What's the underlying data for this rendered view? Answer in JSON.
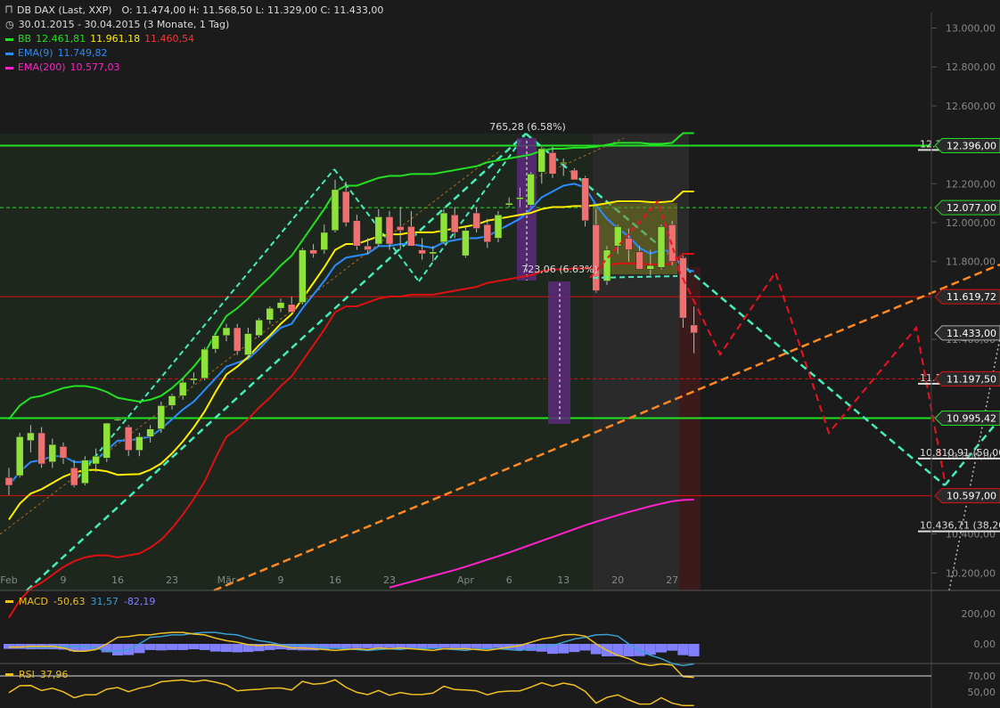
{
  "header": {
    "title": "DB DAX (Last, XXP)",
    "ohlc": "O: 11.474,00  H: 11.568,50  L: 11.329,00  C: 11.433,00",
    "period": "30.01.2015 - 30.04.2015 (3 Monate, 1 Tag)",
    "bb_label": "BB",
    "bb_upper": "12.461,81",
    "bb_mid": "11.961,18",
    "bb_lower": "11.460,54",
    "ema9_label": "EMA(9)",
    "ema9_value": "11.749,82",
    "ema200_label": "EMA(200)",
    "ema200_value": "10.577,03"
  },
  "colors": {
    "background": "#1b1b1b",
    "up_candle": "#8fe23a",
    "down_candle": "#f07070",
    "bb_upper": "#22e022",
    "bb_mid": "#ffee00",
    "bb_lower": "#dd1111",
    "ema9": "#2a8cff",
    "ema200": "#ff22cc",
    "channel": "#44eebb",
    "support_line": "#ff8822",
    "projection": "#ee1122",
    "macd": "#f0c020",
    "macd_signal": "#3aa0d0",
    "macd_hist": "#8080ff",
    "rsi": "#f0c020"
  },
  "annotations": {
    "top_measure": "765,28 (6.58%)",
    "mid_measure": "723,06 (6.63%)"
  },
  "price_badges": [
    {
      "label": "12.396,00",
      "value": 12396,
      "color": "#22e022"
    },
    {
      "label": "12.077,00",
      "value": 12077,
      "color": "#22e022"
    },
    {
      "label": "11.619,72",
      "value": 11619.72,
      "color": "#dd1111"
    },
    {
      "label": "11.433,00",
      "value": 11433,
      "color": "#aaaaaa"
    },
    {
      "label": "11.197,50",
      "value": 11197.5,
      "color": "#dd1111"
    },
    {
      "label": "10.995,42",
      "value": 10995.42,
      "color": "#22e022"
    },
    {
      "label": "10.597,00",
      "value": 10597,
      "color": "#dd1111"
    }
  ],
  "fib_labels": [
    {
      "label": "12.396,40 (100,0",
      "value": 12396.4
    },
    {
      "label": "11.195,11 (61,80",
      "value": 11195.11
    },
    {
      "label": "10.810,91 (50,00",
      "value": 10810.91
    },
    {
      "label": "10.436,71 (38,20",
      "value": 10436.71
    }
  ],
  "chart_data": {
    "type": "candlestick",
    "ylim": [
      10110,
      13080
    ],
    "y_ticks": [
      "13.000,00",
      "12.800,00",
      "12.600,00",
      "12.200,00",
      "12.000,00",
      "11.800,00",
      "11.400,00",
      "11.000,00",
      "10.800,00",
      "10.400,00",
      "10.200,00"
    ],
    "y_tick_values": [
      13000,
      12800,
      12600,
      12200,
      12000,
      11800,
      11400,
      11000,
      10800,
      10400,
      10200
    ],
    "x_labels": [
      "Feb",
      "9",
      "16",
      "23",
      "Mär",
      "9",
      "16",
      "23",
      "Apr",
      "6",
      "13",
      "20",
      "27"
    ],
    "x_label_index": [
      0,
      5,
      10,
      15,
      20,
      25,
      30,
      35,
      42,
      46,
      51,
      56,
      61
    ],
    "candles": [
      {
        "o": 10690,
        "h": 10740,
        "l": 10600,
        "c": 10650
      },
      {
        "o": 10700,
        "h": 10920,
        "l": 10690,
        "c": 10900
      },
      {
        "o": 10880,
        "h": 10960,
        "l": 10820,
        "c": 10920
      },
      {
        "o": 10920,
        "h": 10950,
        "l": 10740,
        "c": 10760
      },
      {
        "o": 10770,
        "h": 10890,
        "l": 10740,
        "c": 10860
      },
      {
        "o": 10850,
        "h": 10870,
        "l": 10760,
        "c": 10790
      },
      {
        "o": 10740,
        "h": 10780,
        "l": 10640,
        "c": 10650
      },
      {
        "o": 10660,
        "h": 10800,
        "l": 10650,
        "c": 10780
      },
      {
        "o": 10760,
        "h": 10840,
        "l": 10720,
        "c": 10800
      },
      {
        "o": 10790,
        "h": 10970,
        "l": 10770,
        "c": 10970
      },
      {
        "o": 10990,
        "h": 11000,
        "l": 10980,
        "c": 10990
      },
      {
        "o": 10950,
        "h": 10960,
        "l": 10800,
        "c": 10830
      },
      {
        "o": 10830,
        "h": 10920,
        "l": 10800,
        "c": 10900
      },
      {
        "o": 10900,
        "h": 10960,
        "l": 10870,
        "c": 10940
      },
      {
        "o": 10940,
        "h": 11080,
        "l": 10920,
        "c": 11060
      },
      {
        "o": 11060,
        "h": 11120,
        "l": 11040,
        "c": 11110
      },
      {
        "o": 11110,
        "h": 11200,
        "l": 11090,
        "c": 11180
      },
      {
        "o": 11190,
        "h": 11230,
        "l": 11170,
        "c": 11200
      },
      {
        "o": 11200,
        "h": 11360,
        "l": 11190,
        "c": 11350
      },
      {
        "o": 11350,
        "h": 11430,
        "l": 11330,
        "c": 11420
      },
      {
        "o": 11420,
        "h": 11480,
        "l": 11390,
        "c": 11460
      },
      {
        "o": 11460,
        "h": 11480,
        "l": 11320,
        "c": 11340
      },
      {
        "o": 11320,
        "h": 11460,
        "l": 11310,
        "c": 11430
      },
      {
        "o": 11420,
        "h": 11510,
        "l": 11410,
        "c": 11500
      },
      {
        "o": 11500,
        "h": 11570,
        "l": 11480,
        "c": 11560
      },
      {
        "o": 11560,
        "h": 11610,
        "l": 11540,
        "c": 11590
      },
      {
        "o": 11580,
        "h": 11620,
        "l": 11540,
        "c": 11540
      },
      {
        "o": 11590,
        "h": 11870,
        "l": 11580,
        "c": 11860
      },
      {
        "o": 11860,
        "h": 11890,
        "l": 11820,
        "c": 11840
      },
      {
        "o": 11860,
        "h": 11990,
        "l": 11840,
        "c": 11950
      },
      {
        "o": 11960,
        "h": 12220,
        "l": 11950,
        "c": 12170
      },
      {
        "o": 12160,
        "h": 12210,
        "l": 11980,
        "c": 12000
      },
      {
        "o": 12010,
        "h": 12040,
        "l": 11860,
        "c": 11880
      },
      {
        "o": 11880,
        "h": 11920,
        "l": 11840,
        "c": 11860
      },
      {
        "o": 11890,
        "h": 12070,
        "l": 11880,
        "c": 12030
      },
      {
        "o": 12030,
        "h": 12060,
        "l": 11860,
        "c": 11890
      },
      {
        "o": 11980,
        "h": 12080,
        "l": 11860,
        "c": 11960
      },
      {
        "o": 11980,
        "h": 12060,
        "l": 11880,
        "c": 11880
      },
      {
        "o": 11860,
        "h": 11920,
        "l": 11810,
        "c": 11840
      },
      {
        "o": 11840,
        "h": 11880,
        "l": 11800,
        "c": 11850
      },
      {
        "o": 11900,
        "h": 12070,
        "l": 11890,
        "c": 12050
      },
      {
        "o": 12040,
        "h": 12080,
        "l": 11920,
        "c": 11950
      },
      {
        "o": 11830,
        "h": 11980,
        "l": 11820,
        "c": 11960
      },
      {
        "o": 12050,
        "h": 12080,
        "l": 11950,
        "c": 11970
      },
      {
        "o": 11990,
        "h": 12020,
        "l": 11870,
        "c": 11900
      },
      {
        "o": 11920,
        "h": 12060,
        "l": 11900,
        "c": 12040
      },
      {
        "o": 12090,
        "h": 12130,
        "l": 12080,
        "c": 12100
      },
      {
        "o": 12120,
        "h": 12180,
        "l": 12080,
        "c": 12130
      },
      {
        "o": 12090,
        "h": 12260,
        "l": 12080,
        "c": 12250
      },
      {
        "o": 12260,
        "h": 12390,
        "l": 12200,
        "c": 12380
      },
      {
        "o": 12360,
        "h": 12390,
        "l": 12230,
        "c": 12250
      },
      {
        "o": 12310,
        "h": 12330,
        "l": 12240,
        "c": 12310
      },
      {
        "o": 12270,
        "h": 12280,
        "l": 12220,
        "c": 12220
      },
      {
        "o": 12230,
        "h": 12240,
        "l": 11980,
        "c": 12010
      },
      {
        "o": 11990,
        "h": 12070,
        "l": 11640,
        "c": 11650
      },
      {
        "o": 11700,
        "h": 11880,
        "l": 11680,
        "c": 11860
      },
      {
        "o": 11880,
        "h": 11990,
        "l": 11840,
        "c": 11980
      },
      {
        "o": 11920,
        "h": 11970,
        "l": 11800,
        "c": 11860
      },
      {
        "o": 11850,
        "h": 11880,
        "l": 11760,
        "c": 11760
      },
      {
        "o": 11760,
        "h": 11860,
        "l": 11730,
        "c": 11780
      },
      {
        "o": 11770,
        "h": 11990,
        "l": 11760,
        "c": 11980
      },
      {
        "o": 11990,
        "h": 12010,
        "l": 11780,
        "c": 11800
      },
      {
        "o": 11820,
        "h": 11830,
        "l": 11460,
        "c": 11510
      },
      {
        "o": 11474,
        "h": 11568.5,
        "l": 11329,
        "c": 11433
      }
    ],
    "series": [
      {
        "name": "BB",
        "values": [
          10990,
          11060,
          11100,
          11110,
          11130,
          11150,
          11160,
          11160,
          11150,
          11130,
          11100,
          11090,
          11080,
          11090,
          11110,
          11150,
          11200,
          11260,
          11330,
          11430,
          11520,
          11560,
          11610,
          11670,
          11720,
          11780,
          11830,
          11910,
          11990,
          12070,
          12160,
          12190,
          12190,
          12210,
          12230,
          12240,
          12240,
          12250,
          12250,
          12250,
          12260,
          12270,
          12280,
          12290,
          12310,
          12320,
          12330,
          12340,
          12350,
          12370,
          12380,
          12380,
          12385,
          12385,
          12390,
          12400,
          12410,
          12410,
          12410,
          12405,
          12405,
          12410,
          12460,
          12460
        ]
      },
      {
        "name": "EMA(9)",
        "values": [
          10650,
          10720,
          10770,
          10780,
          10800,
          10800,
          10770,
          10770,
          10780,
          10830,
          10880,
          10880,
          10890,
          10900,
          10940,
          10990,
          11040,
          11080,
          11140,
          11200,
          11260,
          11280,
          11300,
          11350,
          11410,
          11460,
          11480,
          11560,
          11630,
          11700,
          11780,
          11820,
          11830,
          11840,
          11880,
          11880,
          11890,
          11890,
          11880,
          11870,
          11900,
          11910,
          11920,
          11920,
          11930,
          11960,
          11990,
          12020,
          12070,
          12130,
          12160,
          12190,
          12200,
          12180,
          12090,
          12020,
          11970,
          11930,
          11870,
          11840,
          11860,
          11850,
          11760,
          11749.82
        ]
      },
      {
        "name": "EMA(200)",
        "values": [
          null,
          null,
          null,
          null,
          null,
          null,
          null,
          null,
          null,
          null,
          null,
          null,
          null,
          null,
          null,
          null,
          null,
          null,
          null,
          null,
          null,
          null,
          null,
          null,
          null,
          null,
          null,
          null,
          null,
          null,
          null,
          null,
          null,
          null,
          null,
          10125,
          10140,
          10155,
          10170,
          10185,
          10200,
          10215,
          10232,
          10250,
          10268,
          10286,
          10305,
          10325,
          10345,
          10365,
          10385,
          10405,
          10425,
          10445,
          10463,
          10480,
          10497,
          10513,
          10528,
          10543,
          10556,
          10568,
          10575,
          10577.03
        ]
      }
    ]
  },
  "macd": {
    "label": "MACD",
    "value": "-50,63",
    "signal": "31,57",
    "hist": "-82,19",
    "ticks": [
      "200,00",
      "0,00"
    ]
  },
  "rsi": {
    "label": "RSI",
    "value": "37,96",
    "ticks": [
      "70,00",
      "50,00"
    ]
  }
}
